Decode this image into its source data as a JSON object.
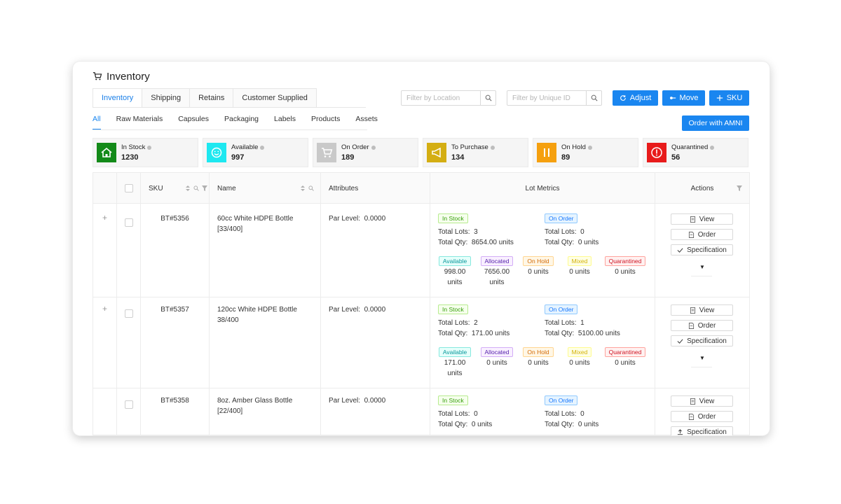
{
  "page": {
    "title": "Inventory"
  },
  "tabs": [
    "Inventory",
    "Shipping",
    "Retains",
    "Customer Supplied"
  ],
  "filters": {
    "location_placeholder": "Filter by Location",
    "unique_id_placeholder": "Filter by Unique ID"
  },
  "actions": {
    "adjust": "Adjust",
    "move": "Move",
    "sku": "SKU",
    "order_amni": "Order with AMNI"
  },
  "subtabs": [
    "All",
    "Raw Materials",
    "Capsules",
    "Packaging",
    "Labels",
    "Products",
    "Assets"
  ],
  "stats": [
    {
      "label": "In Stock",
      "value": "1230",
      "color": "#138a19",
      "icon": "home-icon"
    },
    {
      "label": "Available",
      "value": "997",
      "color": "#1ee8f0",
      "icon": "smile-icon"
    },
    {
      "label": "On Order",
      "value": "189",
      "color": "#c9c9c9",
      "icon": "cart-icon"
    },
    {
      "label": "To Purchase",
      "value": "134",
      "color": "#d4ae13",
      "icon": "megaphone-icon"
    },
    {
      "label": "On Hold",
      "value": "89",
      "color": "#f5a00f",
      "icon": "pause-icon"
    },
    {
      "label": "Quarantined",
      "value": "56",
      "color": "#e81b1b",
      "icon": "alert-icon"
    }
  ],
  "table": {
    "headers": {
      "sku": "SKU",
      "name": "Name",
      "attributes": "Attributes",
      "lot_metrics": "Lot Metrics",
      "actions": "Actions"
    },
    "labels": {
      "in_stock": "In Stock",
      "on_order": "On Order",
      "total_lots": "Total Lots:",
      "total_qty": "Total Qty:",
      "par_level": "Par Level:",
      "available": "Available",
      "allocated": "Allocated",
      "on_hold": "On Hold",
      "mixed": "Mixed",
      "quarantined": "Quarantined",
      "view": "View",
      "order": "Order",
      "specification": "Specification"
    },
    "rows": [
      {
        "sku": "BT#5356",
        "name_line1": "60cc White HDPE Bottle",
        "name_line2": "[33/400]",
        "par_level": "0.0000",
        "in_stock_lots": "3",
        "in_stock_qty": "8654.00 units",
        "on_order_lots": "0",
        "on_order_qty": "0 units",
        "available_1": "998.00",
        "available_2": "units",
        "allocated_1": "7656.00",
        "allocated_2": "units",
        "on_hold": "0 units",
        "mixed": "0 units",
        "quarantined": "0 units"
      },
      {
        "sku": "BT#5357",
        "name_line1": "120cc White HDPE Bottle",
        "name_line2": "38/400",
        "par_level": "0.0000",
        "in_stock_lots": "2",
        "in_stock_qty": "171.00 units",
        "on_order_lots": "1",
        "on_order_qty": "5100.00 units",
        "available_1": "171.00",
        "available_2": "units",
        "allocated_1": "0 units",
        "allocated_2": "",
        "on_hold": "0 units",
        "mixed": "0 units",
        "quarantined": "0 units"
      },
      {
        "sku": "BT#5358",
        "name_line1": "8oz. Amber Glass Bottle",
        "name_line2": "[22/400]",
        "par_level": "0.0000",
        "in_stock_lots": "0",
        "in_stock_qty": "0 units",
        "on_order_lots": "0",
        "on_order_qty": "0 units"
      }
    ]
  }
}
